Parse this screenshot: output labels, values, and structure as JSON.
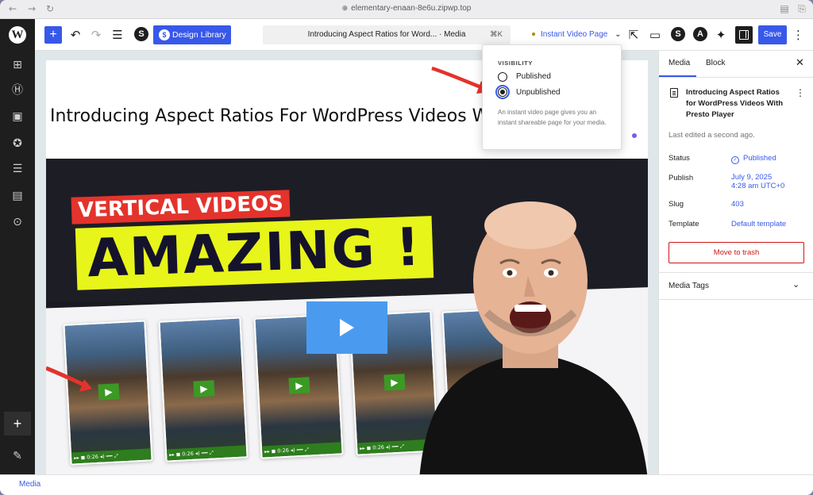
{
  "browser": {
    "url": "elementary-enaan-8e6u.zipwp.top",
    "back_icon": "arrow-left-icon",
    "forward_icon": "arrow-right-icon",
    "reload_icon": "reload-icon"
  },
  "toolbar": {
    "design_library_label": "Design Library",
    "doc_title": "Introducing Aspect Ratios for Word...",
    "doc_type": "· Media",
    "shortcut": "⌘K",
    "instant_video_label": "Instant Video Page",
    "save_label": "Save"
  },
  "popover": {
    "heading": "VISIBILITY",
    "options": [
      {
        "label": "Published",
        "selected": false
      },
      {
        "label": "Unpublished",
        "selected": true
      }
    ],
    "help": "An instant video page gives you an instant shareable page for your media."
  },
  "canvas": {
    "post_title": "Introducing Aspect Ratios For WordPress Videos With Presto Player",
    "thumbnail": {
      "red_label": "VERTICAL VIDEOS",
      "yellow_label": "AMAZING !",
      "phone_time": "0:26"
    }
  },
  "sidebar": {
    "tabs": [
      "Media",
      "Block"
    ],
    "active_tab": "Media",
    "post_title": "Introducing Aspect Ratios for WordPress Videos With Presto Player",
    "last_edited": "Last edited a second ago.",
    "rows": [
      {
        "key": "Status",
        "value": "Published"
      },
      {
        "key": "Publish",
        "value": "July 9, 2025",
        "value2": "4:28 am UTC+0"
      },
      {
        "key": "Slug",
        "value": "403"
      },
      {
        "key": "Template",
        "value": "Default template"
      }
    ],
    "trash_label": "Move to trash",
    "media_tags_label": "Media Tags"
  },
  "footer": {
    "label": "Media"
  },
  "colors": {
    "accent": "#3858e9",
    "danger": "#cc1818",
    "thumbnail_red": "#e3332c",
    "thumbnail_yellow": "#e8f51a"
  }
}
